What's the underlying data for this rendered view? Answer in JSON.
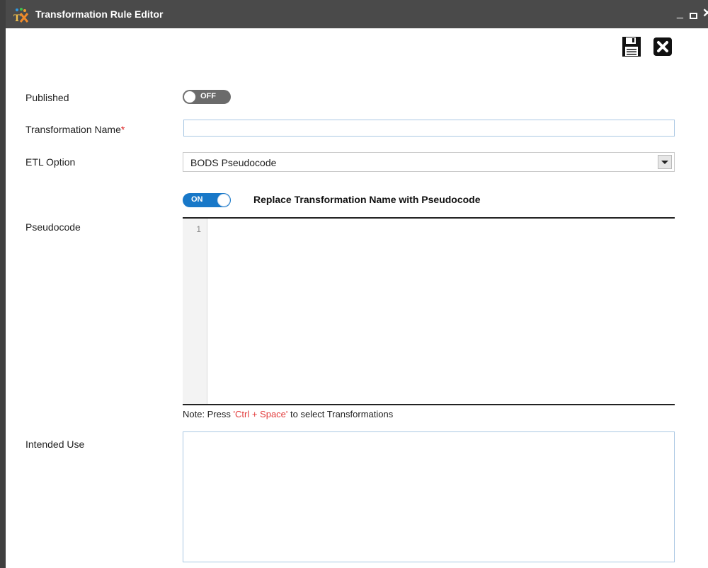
{
  "window": {
    "title": "Transformation Rule Editor",
    "minimize": "_",
    "close": "✕"
  },
  "toolbar": {
    "save_icon": "floppy-disk-icon",
    "close_icon": "close-x-icon"
  },
  "form": {
    "published": {
      "label": "Published",
      "toggle_text": "OFF"
    },
    "transformation_name": {
      "label": "Transformation Name",
      "required_mark": "*",
      "value": ""
    },
    "etl_option": {
      "label": "ETL Option",
      "selected": "BODS Pseudocode"
    },
    "replace_toggle": {
      "toggle_text": "ON",
      "label": "Replace Transformation Name with Pseudocode"
    },
    "pseudocode": {
      "label": "Pseudocode",
      "line_number": "1"
    },
    "note": {
      "prefix": "Note: Press ",
      "shortcut": "'Ctrl + Space'",
      "suffix": " to select Transformations"
    },
    "intended_use": {
      "label": "Intended Use"
    }
  },
  "colors": {
    "titlebar": "#4a4a4a",
    "toggle_on": "#1878c8",
    "toggle_off": "#6b6b6b",
    "note_highlight": "#e23a3a"
  }
}
